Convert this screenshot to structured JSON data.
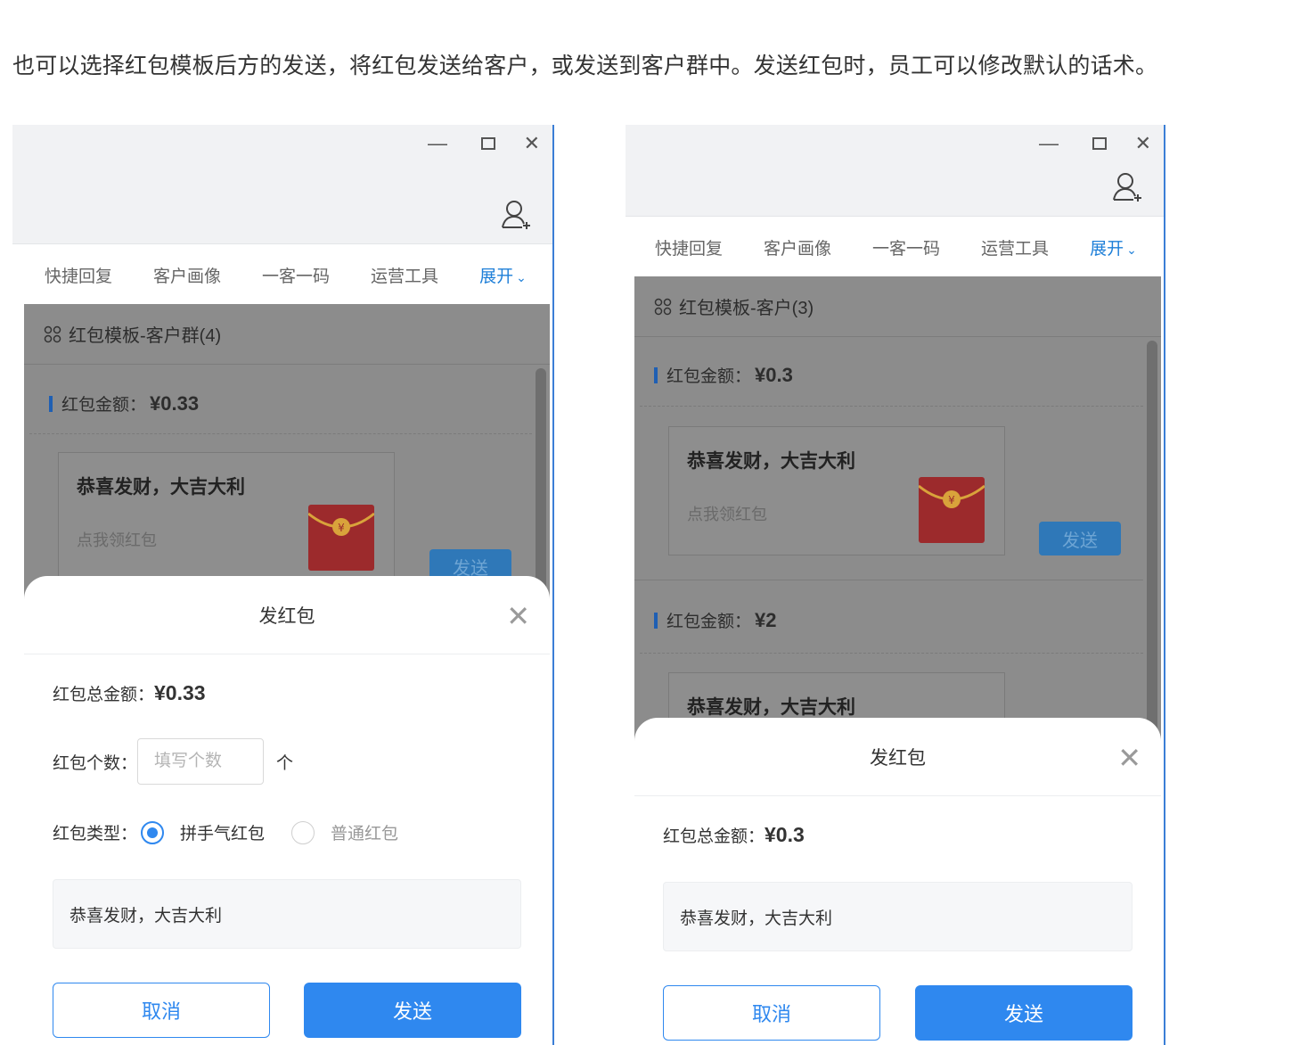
{
  "intro_text": "也可以选择红包模板后方的发送，将红包发送给客户，或发送到客户群中。发送红包时，员工可以修改默认的话术。",
  "colors": {
    "accent": "#2f88ef",
    "overlay": "#8c8c8c",
    "envelope": "#c0282d"
  },
  "window_controls": {
    "minimize": "—",
    "close": "✕"
  },
  "left": {
    "nav": [
      "快捷回复",
      "客户画像",
      "一客一码",
      "运营工具"
    ],
    "nav_expand": "展开",
    "template_title": "红包模板-客户群(4)",
    "amount_label": "红包金额：",
    "amount_value": "¥0.33",
    "card_title": "恭喜发财，大吉大利",
    "card_sub": "点我领红包",
    "send_small": "发送",
    "dialog": {
      "title": "发红包",
      "total_label": "红包总金额：",
      "total_value": "¥0.33",
      "count_label": "红包个数：",
      "count_placeholder": "填写个数",
      "count_unit": "个",
      "type_label": "红包类型：",
      "type_options": [
        "拼手气红包",
        "普通红包"
      ],
      "type_selected": "拼手气红包",
      "message": "恭喜发财，大吉大利",
      "cancel": "取消",
      "send": "发送"
    }
  },
  "right": {
    "nav": [
      "快捷回复",
      "客户画像",
      "一客一码",
      "运营工具"
    ],
    "nav_expand": "展开",
    "template_title": "红包模板-客户(3)",
    "items": [
      {
        "amount_label": "红包金额：",
        "amount_value": "¥0.3",
        "card_title": "恭喜发财，大吉大利",
        "card_sub": "点我领红包",
        "send_small": "发送"
      },
      {
        "amount_label": "红包金额：",
        "amount_value": "¥2",
        "card_title": "恭喜发财，大吉大利"
      }
    ],
    "dialog": {
      "title": "发红包",
      "total_label": "红包总金额：",
      "total_value": "¥0.3",
      "message": "恭喜发财，大吉大利",
      "cancel": "取消",
      "send": "发送"
    }
  }
}
